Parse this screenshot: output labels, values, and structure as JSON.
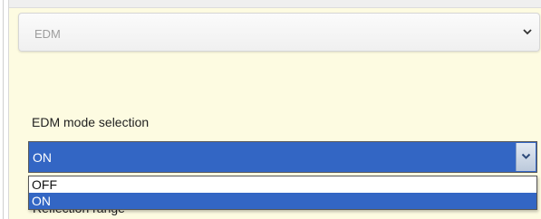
{
  "section": {
    "title": "EDM",
    "icon": "chevron-down-icon"
  },
  "edm_mode": {
    "label": "EDM mode selection",
    "selected": "ON",
    "button_icon": "chevron-down-icon",
    "options": [
      "OFF",
      "ON"
    ],
    "highlighted_option": "ON"
  },
  "obscured_label": "Reflection range",
  "colors": {
    "panel_background": "#fdfbe1",
    "selection_blue": "#3366c4",
    "section_header_text": "#9e9e9e"
  }
}
